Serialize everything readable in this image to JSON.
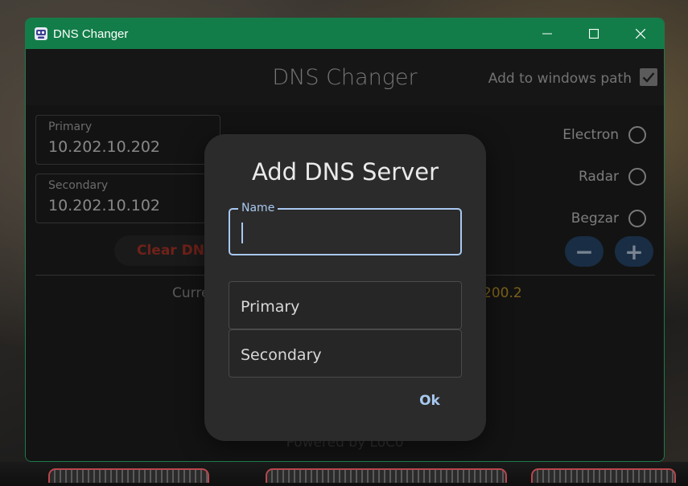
{
  "window": {
    "title": "DNS Changer",
    "accent": "#137d49",
    "controls": [
      "minimize-icon",
      "maximize-icon",
      "close-icon"
    ]
  },
  "header": {
    "heading": "DNS Changer",
    "add_path_label": "Add to windows path",
    "add_path_checked": true
  },
  "dns": {
    "primary_label": "Primary",
    "primary_value": "10.202.10.202",
    "secondary_label": "Secondary",
    "secondary_value": "10.202.10.102",
    "clear_label": "Clear DNS"
  },
  "current": {
    "left_text": "Curre",
    "right_text": "200.2"
  },
  "servers": [
    {
      "label": "Electron",
      "selected": false
    },
    {
      "label": "Radar",
      "selected": false
    },
    {
      "label": "Begzar",
      "selected": false
    }
  ],
  "buttons": {
    "remove": "−",
    "add": "+"
  },
  "footer": "Powered by LoCo",
  "dialog": {
    "title": "Add DNS Server",
    "name_label": "Name",
    "name_value": "",
    "primary_placeholder": "Primary",
    "secondary_placeholder": "Secondary",
    "ok_label": "Ok"
  }
}
